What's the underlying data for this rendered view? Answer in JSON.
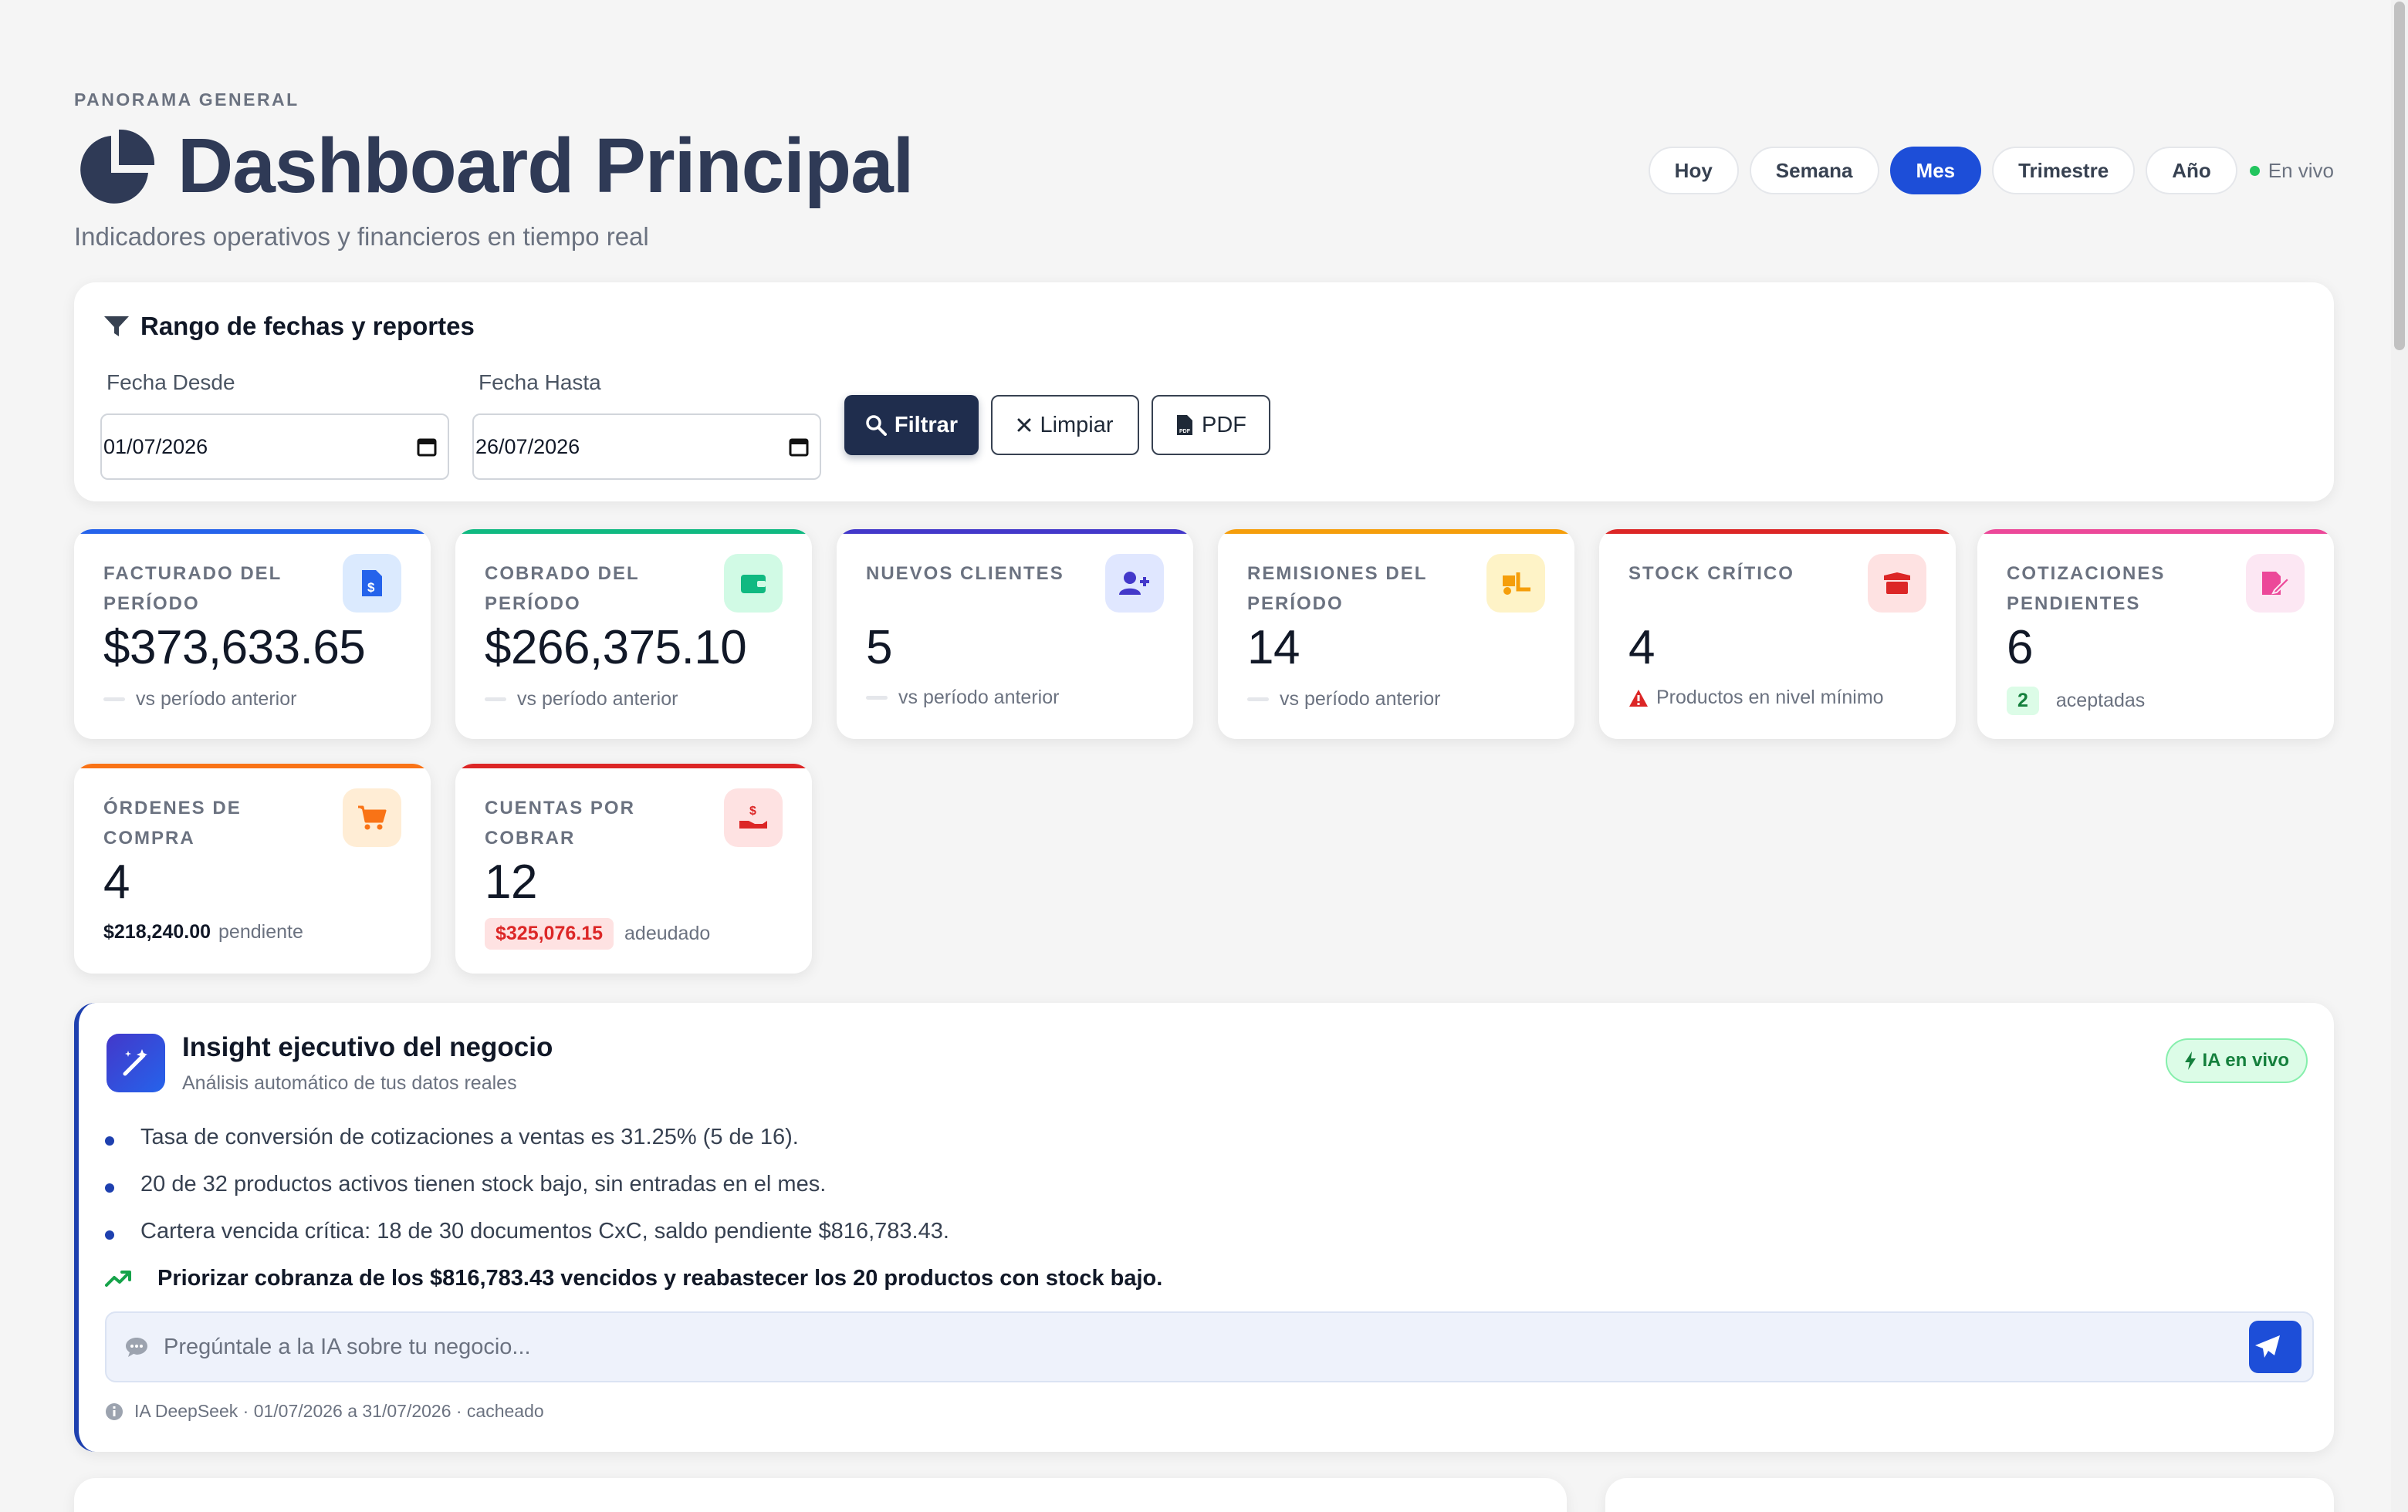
{
  "header": {
    "eyebrow": "PANORAMA GENERAL",
    "title": "Dashboard Principal",
    "subtitle": "Indicadores operativos y financieros en tiempo real",
    "periods": [
      "Hoy",
      "Semana",
      "Mes",
      "Trimestre",
      "Año"
    ],
    "active_period": "Mes",
    "live_label": "En vivo"
  },
  "filter": {
    "title": "Rango de fechas y reportes",
    "from_label": "Fecha Desde",
    "from_value": "01/07/2026",
    "to_label": "Fecha Hasta",
    "to_value": "26/07/2026",
    "filter_btn": "Filtrar",
    "clear_btn": "Limpiar",
    "pdf_btn": "PDF"
  },
  "kpis": {
    "facturado": {
      "label": "Facturado del período",
      "value": "$373,633.65",
      "foot": "vs período anterior",
      "color": "#2563eb"
    },
    "cobrado": {
      "label": "Cobrado del período",
      "value": "$266,375.10",
      "foot": "vs período anterior",
      "color": "#10b981"
    },
    "clientes": {
      "label": "Nuevos clientes",
      "value": "5",
      "foot": "vs período anterior",
      "color": "#4338ca"
    },
    "remisiones": {
      "label": "Remisiones del período",
      "value": "14",
      "foot": "vs período anterior",
      "color": "#f59e0b"
    },
    "stock": {
      "label": "Stock crítico",
      "value": "4",
      "foot": "Productos en nivel mínimo",
      "color": "#dc2626"
    },
    "cotizaciones": {
      "label": "Cotizaciones pendientes",
      "value": "6",
      "chip": "2",
      "foot": "aceptadas",
      "color": "#ec4899"
    },
    "ordenes": {
      "label": "Órdenes de compra",
      "value": "4",
      "amount": "$218,240.00",
      "foot": "pendiente",
      "color": "#f97316"
    },
    "cuentas": {
      "label": "Cuentas por cobrar",
      "value": "12",
      "amount": "$325,076.15",
      "foot": "adeudado",
      "color": "#dc2626"
    }
  },
  "insight": {
    "title": "Insight ejecutivo del negocio",
    "subtitle": "Análisis automático de tus datos reales",
    "badge": "IA en vivo",
    "items": [
      "Tasa de conversión de cotizaciones a ventas es 31.25% (5 de 16).",
      "20 de 32 productos activos tienen stock bajo, sin entradas en el mes.",
      "Cartera vencida crítica: 18 de 30 documentos CxC, saldo pendiente $816,783.43."
    ],
    "recommendation": "Priorizar cobranza de los $816,783.43 vencidos y reabastecer los 20 productos con stock bajo.",
    "ask_placeholder": "Pregúntale a la IA sobre tu negocio...",
    "footer": "IA DeepSeek · 01/07/2026 a 31/07/2026 · cacheado"
  }
}
